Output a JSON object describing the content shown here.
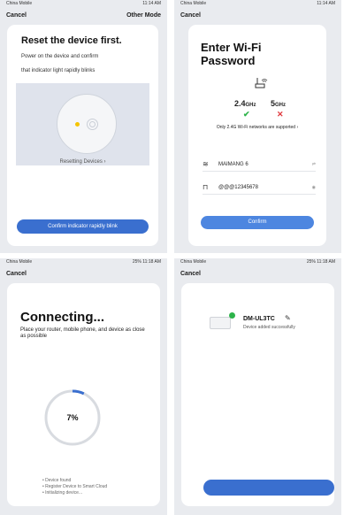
{
  "panel1": {
    "status_left": "China Mobile",
    "status_right": "11:14 AM",
    "cancel": "Cancel",
    "right_action": "Other Mode",
    "title": "Reset the device first.",
    "line1": "Power on the device and confirm",
    "line2": "that indicator light rapidly blinks",
    "resetting_link": "Resetting Devices",
    "confirm_button": "Confirm indicator rapidly blink"
  },
  "panel2": {
    "status_left": "China Mobile",
    "status_right": "11:14 AM",
    "cancel": "Cancel",
    "title_line1": "Enter Wi-Fi",
    "title_line2": "Password",
    "band1": "2.4",
    "band1_unit": "GHz",
    "band2": "5",
    "band2_unit": "GHz",
    "band1_mark": "✔",
    "band2_mark": "✕",
    "note": "Only 2.4G Wi-Fi networks are supported",
    "ssid": "MAIMANG 6",
    "ssid_trail": "⇌",
    "password": "@@@12345678",
    "password_trail": "◉",
    "confirm_button": "Confirm"
  },
  "panel3": {
    "status_left": "China Mobile",
    "status_right": "25% 11:18 AM",
    "cancel": "Cancel",
    "title": "Connecting...",
    "subtitle": "Place your router, mobile phone, and device as close as possible",
    "percent_text": "7%",
    "progress": 0.07,
    "step1": "Device found",
    "step2": "Register Device to Smart Cloud",
    "step3": "Initializing device..."
  },
  "panel4": {
    "status_left": "China Mobile",
    "status_right": "25% 11:18 AM",
    "cancel": "Cancel",
    "device_name": "DM-UL3TC",
    "device_status": "Device added successfully"
  },
  "colors": {
    "accent": "#3a6fcf",
    "success": "#2db34a",
    "error": "#e0393e"
  }
}
